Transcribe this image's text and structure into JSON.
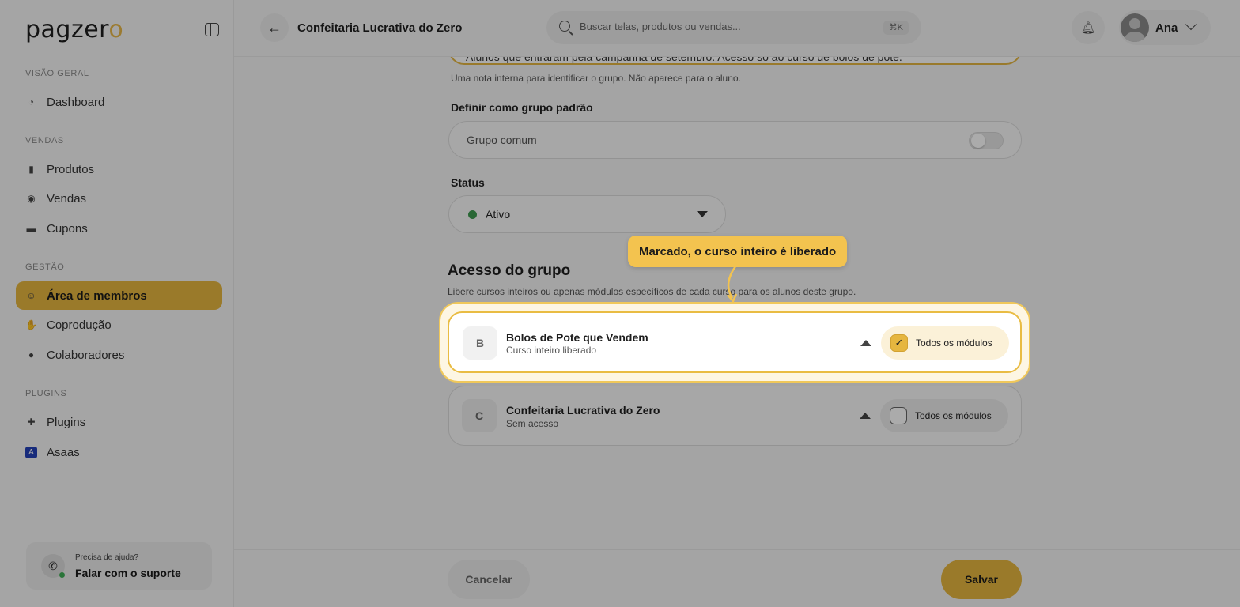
{
  "brand": {
    "logo_main": "pagzer",
    "logo_accent": "o",
    "accent_color": "#e6b63f"
  },
  "sidebar": {
    "sections": [
      {
        "label": "VISÃO GERAL",
        "items": [
          {
            "label": "Dashboard",
            "icon": "dashboard-icon"
          }
        ]
      },
      {
        "label": "VENDAS",
        "items": [
          {
            "label": "Produtos",
            "icon": "products-icon"
          },
          {
            "label": "Vendas",
            "icon": "sales-icon"
          },
          {
            "label": "Cupons",
            "icon": "coupon-icon"
          }
        ]
      },
      {
        "label": "GESTÃO",
        "items": [
          {
            "label": "Área de membros",
            "icon": "members-icon",
            "active": true
          },
          {
            "label": "Coprodução",
            "icon": "handshake-icon"
          },
          {
            "label": "Colaboradores",
            "icon": "user-icon"
          }
        ]
      },
      {
        "label": "PLUGINS",
        "items": [
          {
            "label": "Plugins",
            "icon": "puzzle-icon"
          },
          {
            "label": "Asaas",
            "icon": "asaas-icon"
          }
        ]
      }
    ],
    "support": {
      "small": "Precisa de ajuda?",
      "main": "Falar com o suporte"
    }
  },
  "header": {
    "title": "Confeitaria Lucrativa do Zero",
    "search_placeholder": "Buscar telas, produtos ou vendas...",
    "search_shortcut": "⌘K",
    "user_name": "Ana"
  },
  "form": {
    "description_value": "Alunos que entraram pela campanha de setembro. Acesso só ao curso de bolos de pote.",
    "description_hint": "Uma nota interna para identificar o grupo. Não aparece para o aluno.",
    "default_group_label": "Definir como grupo padrão",
    "default_group_toggle_label": "Grupo comum",
    "default_group_on": false,
    "status_label": "Status",
    "status_value": "Ativo",
    "status_color": "#3e9a4f"
  },
  "access": {
    "title": "Acesso do grupo",
    "description": "Libere cursos inteiros ou apenas módulos específicos de cada curso para os alunos deste grupo.",
    "courses": [
      {
        "initial": "B",
        "name": "Bolos de Pote que Vendem",
        "status": "Curso inteiro liberado",
        "all_modules_label": "Todos os módulos",
        "checked": true
      },
      {
        "initial": "C",
        "name": "Confeitaria Lucrativa do Zero",
        "status": "Sem acesso",
        "all_modules_label": "Todos os módulos",
        "checked": false
      }
    ]
  },
  "footer": {
    "cancel_label": "Cancelar",
    "save_label": "Salvar"
  },
  "tour": {
    "tooltip": "Marcado, o curso inteiro é liberado"
  }
}
